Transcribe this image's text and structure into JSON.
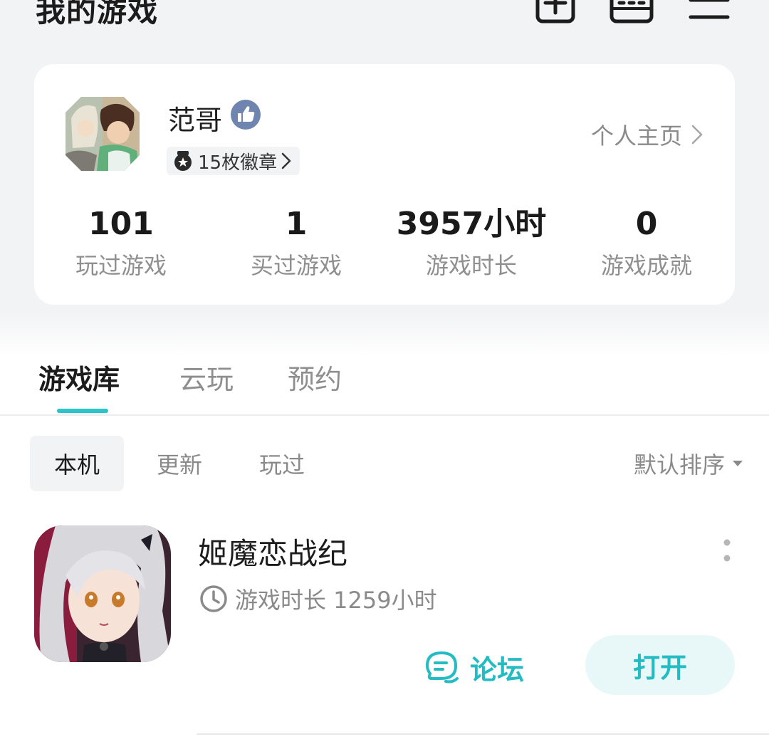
{
  "header": {
    "title": "我的游戏",
    "icons": [
      "add-square-icon",
      "calendar-icon",
      "menu-icon"
    ]
  },
  "profile": {
    "name": "范哥",
    "badges": "15枚徽章",
    "homepage_link": "个人主页",
    "stats": [
      {
        "value": "101",
        "label": "玩过游戏"
      },
      {
        "value": "1",
        "label": "买过游戏"
      },
      {
        "value": "3957小时",
        "label": "游戏时长"
      },
      {
        "value": "0",
        "label": "游戏成就"
      }
    ]
  },
  "tabs": [
    {
      "label": "游戏库",
      "active": true
    },
    {
      "label": "云玩",
      "active": false
    },
    {
      "label": "预约",
      "active": false
    }
  ],
  "filters": [
    {
      "label": "本机",
      "active": true
    },
    {
      "label": "更新",
      "active": false
    },
    {
      "label": "玩过",
      "active": false
    }
  ],
  "sort": {
    "label": "默认排序"
  },
  "games": [
    {
      "title": "姬魔恋战纪",
      "playtime": "游戏时长 1259小时",
      "forum_label": "论坛",
      "open_label": "打开"
    }
  ],
  "colors": {
    "accent": "#23bcc3",
    "accent_light": "#e8f8f8",
    "page_bg": "#f2f3f5",
    "muted_text": "#8a8a8a",
    "verified": "#6f85b0"
  }
}
